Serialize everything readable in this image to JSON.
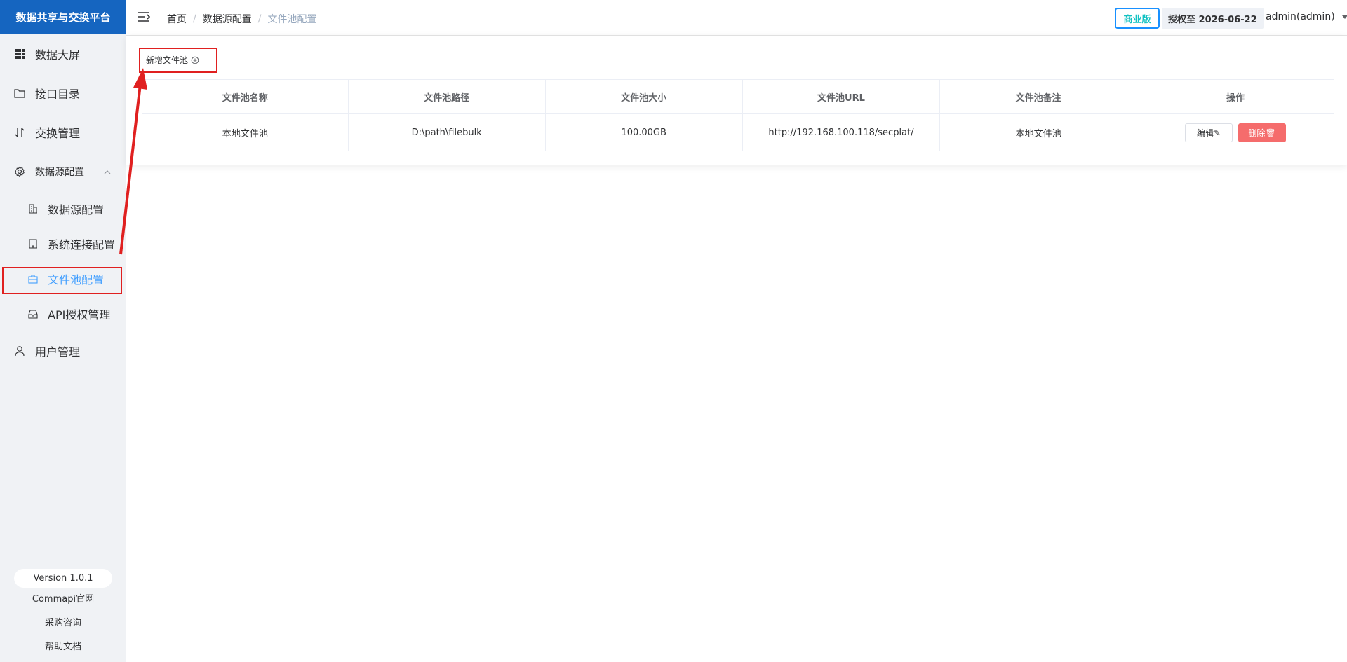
{
  "app": {
    "title": "数据共享与交换平台"
  },
  "sidebar": {
    "items": [
      {
        "label": "数据大屏"
      },
      {
        "label": "接口目录"
      },
      {
        "label": "交换管理"
      },
      {
        "label": "数据源配置"
      },
      {
        "label": "用户管理"
      }
    ],
    "sub_items": [
      {
        "label": "数据源配置"
      },
      {
        "label": "系统连接配置"
      },
      {
        "label": "文件池配置"
      },
      {
        "label": "API授权管理"
      }
    ],
    "version": "Version 1.0.1",
    "links": [
      "Commapi官网",
      "采购咨询",
      "帮助文档"
    ]
  },
  "header": {
    "breadcrumb": [
      "首页",
      "数据源配置",
      "文件池配置"
    ],
    "edition": "商业版",
    "license": "授权至 2026-06-22",
    "user": "admin(admin)"
  },
  "main": {
    "add_button": "新增文件池",
    "table": {
      "columns": [
        "文件池名称",
        "文件池路径",
        "文件池大小",
        "文件池URL",
        "文件池备注",
        "操作"
      ],
      "rows": [
        {
          "name": "本地文件池",
          "path": "D:\\path\\filebulk",
          "size": "100.00GB",
          "url": "http://192.168.100.118/secplat/",
          "remark": "本地文件池"
        }
      ],
      "edit_label": "编辑",
      "delete_label": "删除"
    }
  },
  "colors": {
    "brand": "#1565c0",
    "active": "#409eff",
    "danger": "#f56c6c",
    "highlight": "#e02020"
  }
}
